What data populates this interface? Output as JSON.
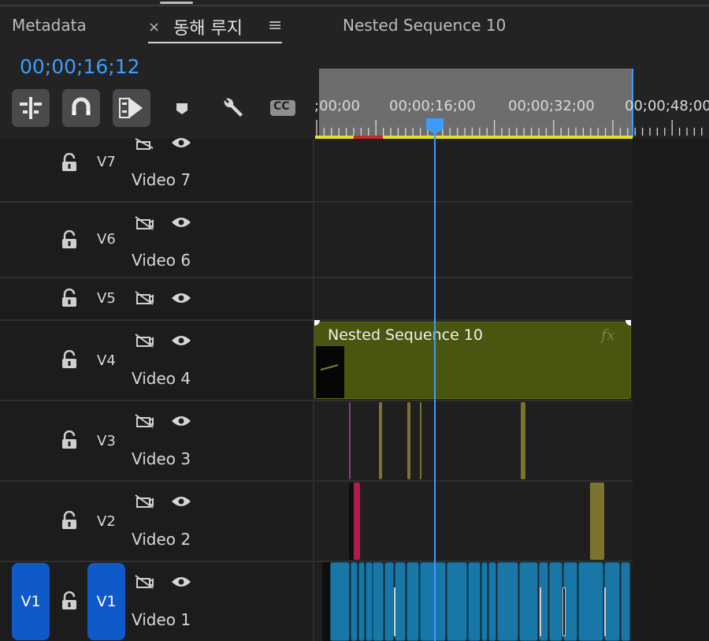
{
  "tabs": {
    "metadata": "Metadata",
    "active": "동해 루지",
    "sequence": "Nested Sequence 10",
    "close_glyph": "×",
    "menu_glyph": "≡"
  },
  "timecode": "00;00;16;12",
  "ruler": {
    "labels": [
      ";00;00",
      "00;00;16;00",
      "00;00;32;00",
      "00;00;48;00"
    ]
  },
  "tools": [
    "insert-snap-icon",
    "magnet-icon",
    "linked-selection-icon",
    "marker-icon",
    "wrench-icon",
    "captions-icon"
  ],
  "captions_label": "CC",
  "tracks": [
    {
      "id": "V7",
      "name": "Video 7"
    },
    {
      "id": "V6",
      "name": "Video 6"
    },
    {
      "id": "V5",
      "name": ""
    },
    {
      "id": "V4",
      "name": "Video 4"
    },
    {
      "id": "V3",
      "name": "Video 3"
    },
    {
      "id": "V2",
      "name": "Video 2"
    },
    {
      "id": "V1",
      "name": "Video 1"
    }
  ],
  "v1_source": "V1",
  "v1_target": "V1",
  "nested_clip": {
    "label": "Nested Sequence 10",
    "fx": "fx"
  },
  "colors": {
    "accent": "#3d9cff",
    "nested_clip": "#4a5510",
    "v1_clips": "#1877a6",
    "work_area": "#e8e21b",
    "v1_button": "#1059c8"
  }
}
